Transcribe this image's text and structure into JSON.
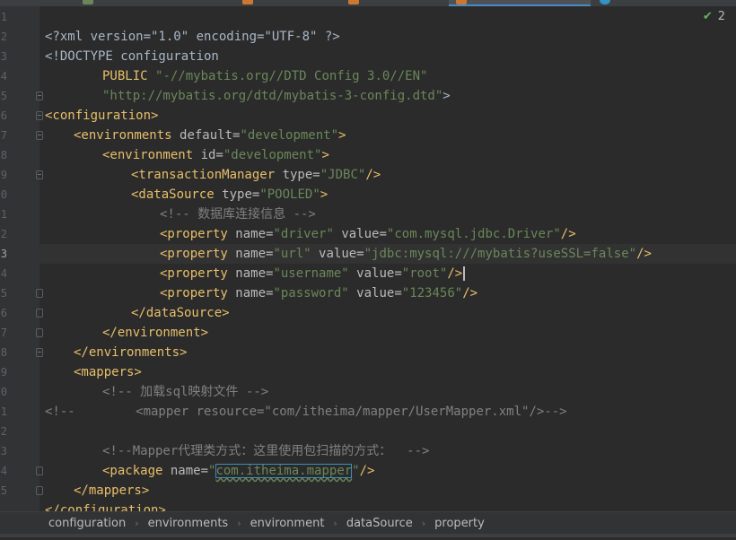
{
  "tabs": [
    {
      "label": "",
      "icon": "tab-file-icon",
      "color": "#6a8759",
      "active": false
    },
    {
      "label": "",
      "icon": "xml-file-icon",
      "color": "#cc7832",
      "active": false
    },
    {
      "label": "",
      "icon": "xml-file-icon",
      "color": "#cc7832",
      "active": true
    },
    {
      "label": "",
      "icon": "java-class-icon",
      "color": "#3592c4",
      "active": false
    }
  ],
  "inspection": {
    "icon": "check-icon",
    "count": "2"
  },
  "gutter": {
    "numbers": [
      "1",
      "2",
      "3",
      "4",
      "5",
      "6",
      "7",
      "8",
      "9",
      "0",
      "1",
      "2",
      "3",
      "4",
      "5",
      "6",
      "7",
      "8",
      "9",
      "0",
      "1",
      "2",
      "3",
      "4",
      "5"
    ],
    "current_line_index": 12
  },
  "code": {
    "l1": {
      "a": "<?xml version=\"1.0\" encoding=\"UTF-8\" ?>"
    },
    "l2": {
      "a": "<!DOCTYPE configuration"
    },
    "l3": {
      "a": "PUBLIC ",
      "b": "\"-//mybatis.org//DTD Config 3.0//EN\""
    },
    "l4": {
      "b": "\"http://mybatis.org/dtd/mybatis-3-config.dtd\"",
      "c": ">"
    },
    "l5": {
      "tag": "<configuration>"
    },
    "l6": {
      "tag": "<environments ",
      "attr": "default=",
      "val": "\"development\"",
      "end": ">"
    },
    "l7": {
      "tag": "<environment ",
      "attr": "id=",
      "val": "\"development\"",
      "end": ">"
    },
    "l8": {
      "tag": "<transactionManager ",
      "attr": "type=",
      "val": "\"JDBC\"",
      "end": "/>"
    },
    "l9": {
      "tag": "<dataSource ",
      "attr": "type=",
      "val": "\"POOLED\"",
      "end": ">"
    },
    "l10": {
      "comment": "<!-- 数据库连接信息 -->"
    },
    "l11": {
      "tag": "<property ",
      "attr1": "name=",
      "val1": "\"driver\"",
      "attr2": " value=",
      "val2": "\"com.mysql.jdbc.Driver\"",
      "end": "/>"
    },
    "l12": {
      "tag": "<property ",
      "attr1": "name=",
      "val1": "\"url\"",
      "attr2": " value=",
      "val2": "\"jdbc:mysql:///mybatis?useSSL=false\"",
      "end": "/>"
    },
    "l13": {
      "tag": "<property ",
      "attr1": "name=",
      "val1": "\"username\"",
      "attr2": " value=",
      "val2": "\"root\"",
      "end": "/>"
    },
    "l14": {
      "tag": "<property ",
      "attr1": "name=",
      "val1": "\"password\"",
      "attr2": " value=",
      "val2": "\"123456\"",
      "end": "/>"
    },
    "l15": {
      "tag": "</dataSource>"
    },
    "l16": {
      "tag": "</environment>"
    },
    "l17": {
      "tag": "</environments>"
    },
    "l18": {
      "tag": "<mappers>"
    },
    "l19": {
      "comment": "<!-- 加载sql映射文件 -->"
    },
    "l20": {
      "prefix": "<!--",
      "body": "        <mapper resource=\"com/itheima/mapper/UserMapper.xml\"/>-->"
    },
    "l21": {},
    "l22": {
      "comment": "<!--Mapper代理类方式：这里使用包扫描的方式：  -->"
    },
    "l23": {
      "tag": "<package ",
      "attr": "name=",
      "q1": "\"",
      "pkg": "com.itheima.mapper",
      "q2": "\"",
      "end": "/>"
    },
    "l24": {
      "tag": "</mappers>"
    },
    "l25": {
      "tag": "</configuration>"
    }
  },
  "breadcrumbs": [
    "configuration",
    "environments",
    "environment",
    "dataSource",
    "property"
  ]
}
